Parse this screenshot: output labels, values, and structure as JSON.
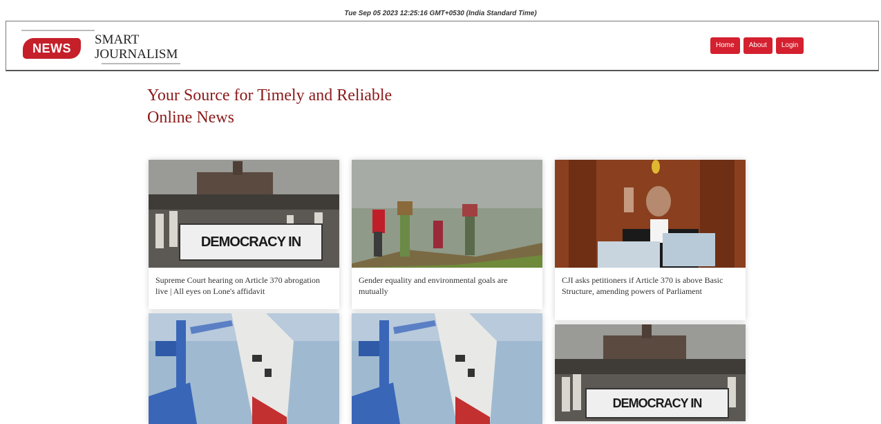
{
  "clock": "Tue Sep 05 2023 12:25:16 GMT+0530 (India Standard Time)",
  "brand": {
    "badge": "NEWS",
    "line1": "SMART",
    "line2": "JOURNALISM"
  },
  "nav": {
    "home": "Home",
    "about": "About",
    "login": "Login"
  },
  "hero": {
    "line1": "Your Source for Timely and Reliable",
    "line2": "Online News"
  },
  "cards": [
    {
      "caption": "Supreme Court hearing on Article 370 abrogation live | All eyes on Lone's affidavit",
      "banner": "DEMOCRACY IN DANGER"
    },
    {
      "caption": "Gender equality and environmental goals are mutually",
      "banner": ""
    },
    {
      "caption": "CJI asks petitioners if Article 370 is above Basic Structure, amending powers of Parliament",
      "banner": ""
    },
    {
      "caption": "",
      "banner": ""
    },
    {
      "caption": "",
      "banner": ""
    },
    {
      "caption": "",
      "banner": "DEMOCRACY IN DANGER"
    }
  ]
}
